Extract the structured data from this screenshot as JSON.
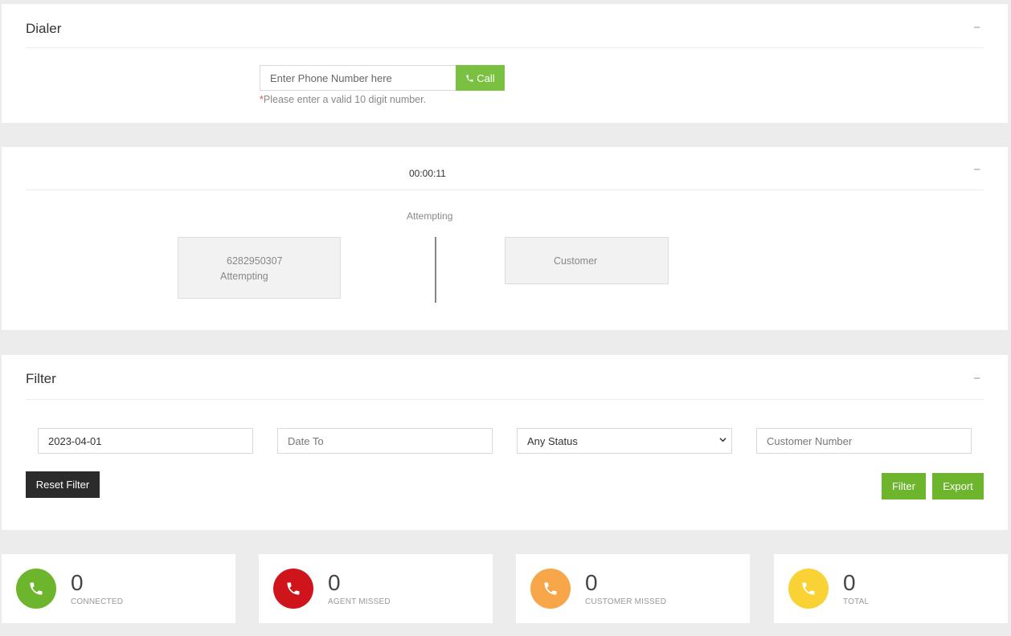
{
  "dialer": {
    "title": "Dialer",
    "collapse_symbol": "−",
    "phone_placeholder": "Enter Phone Number here",
    "call_label": "Call",
    "hint_star": "*",
    "hint_text": "Please enter a valid 10 digit number."
  },
  "call": {
    "timer": "00:00:11",
    "collapse_symbol": "−",
    "status": "Attempting",
    "agent_number": "6282950307",
    "agent_status": "Attempting",
    "customer_label": "Customer"
  },
  "filter": {
    "title": "Filter",
    "collapse_symbol": "−",
    "date_from": "2023-04-01",
    "date_to_placeholder": "Date To",
    "status_selected": "Any Status",
    "customer_placeholder": "Customer Number",
    "reset_label": "Reset Filter",
    "filter_label": "Filter",
    "export_label": "Export"
  },
  "stats": [
    {
      "value": "0",
      "label": "CONNECTED",
      "color": "#6cb52d",
      "icon": "phone-icon"
    },
    {
      "value": "0",
      "label": "AGENT MISSED",
      "color": "#d0141b",
      "icon": "phone-icon"
    },
    {
      "value": "0",
      "label": "CUSTOMER MISSED",
      "color": "#f7a74a",
      "icon": "phone-icon"
    },
    {
      "value": "0",
      "label": "TOTAL",
      "color": "#f9d235",
      "icon": "phone-icon"
    }
  ]
}
